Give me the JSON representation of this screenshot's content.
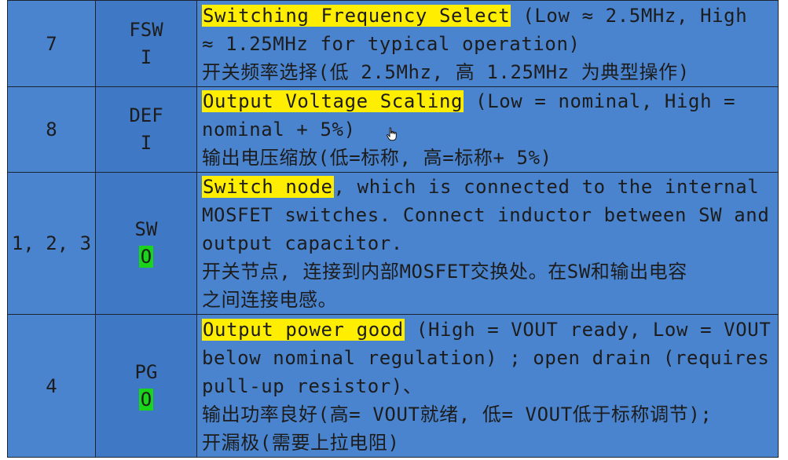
{
  "rows": [
    {
      "number": "7",
      "name": "FSW",
      "io": "I",
      "io_highlight": false,
      "lines": [
        {
          "hl": "Switching Frequency Select",
          "rest": " (Low ≈ 2.5MHz, High"
        },
        {
          "hl": "",
          "rest": "≈ 1.25MHz for typical operation)"
        },
        {
          "hl": "",
          "rest": "开关频率选择(低 2.5Mhz, 高 1.25MHz 为典型操作)"
        }
      ]
    },
    {
      "number": "8",
      "name": "DEF",
      "io": "I",
      "io_highlight": false,
      "lines": [
        {
          "hl": "Output Voltage Scaling",
          "rest": " (Low = nominal, High ="
        },
        {
          "hl": "",
          "rest": "nominal + 5%)"
        },
        {
          "hl": "",
          "rest": "输出电压缩放(低=标称, 高=标称+ 5%)"
        }
      ]
    },
    {
      "number": "1, 2, 3",
      "name": "SW",
      "io": "O",
      "io_highlight": true,
      "lines": [
        {
          "hl": "Switch node",
          "rest": ", which is connected to the internal"
        },
        {
          "hl": "",
          "rest": "MOSFET switches. Connect inductor between SW and"
        },
        {
          "hl": "",
          "rest": "output capacitor."
        },
        {
          "hl": "",
          "rest": "开关节点, 连接到内部MOSFET交换处。在SW和输出电容"
        },
        {
          "hl": "",
          "rest": "之间连接电感。"
        }
      ]
    },
    {
      "number": "4",
      "name": "PG",
      "io": "O",
      "io_highlight": true,
      "lines": [
        {
          "hl": "Output power good",
          "rest": " (High = VOUT ready, Low = VOUT"
        },
        {
          "hl": "",
          "rest": "below nominal regulation) ; open drain (requires"
        },
        {
          "hl": "",
          "rest": "pull-up resistor)、"
        },
        {
          "hl": "",
          "rest": "输出功率良好(高= VOUT就绪, 低= VOUT低于标称调节);"
        },
        {
          "hl": "",
          "rest": "开漏极(需要上拉电阻)"
        }
      ]
    }
  ],
  "colors": {
    "cell_bg": "#4a84cf",
    "name_bg": "#3f79c5",
    "highlight_yellow": "#ffee00",
    "highlight_green": "#19d419",
    "border": "#1b2430"
  },
  "cursor_icon": "hand-pointer-icon"
}
